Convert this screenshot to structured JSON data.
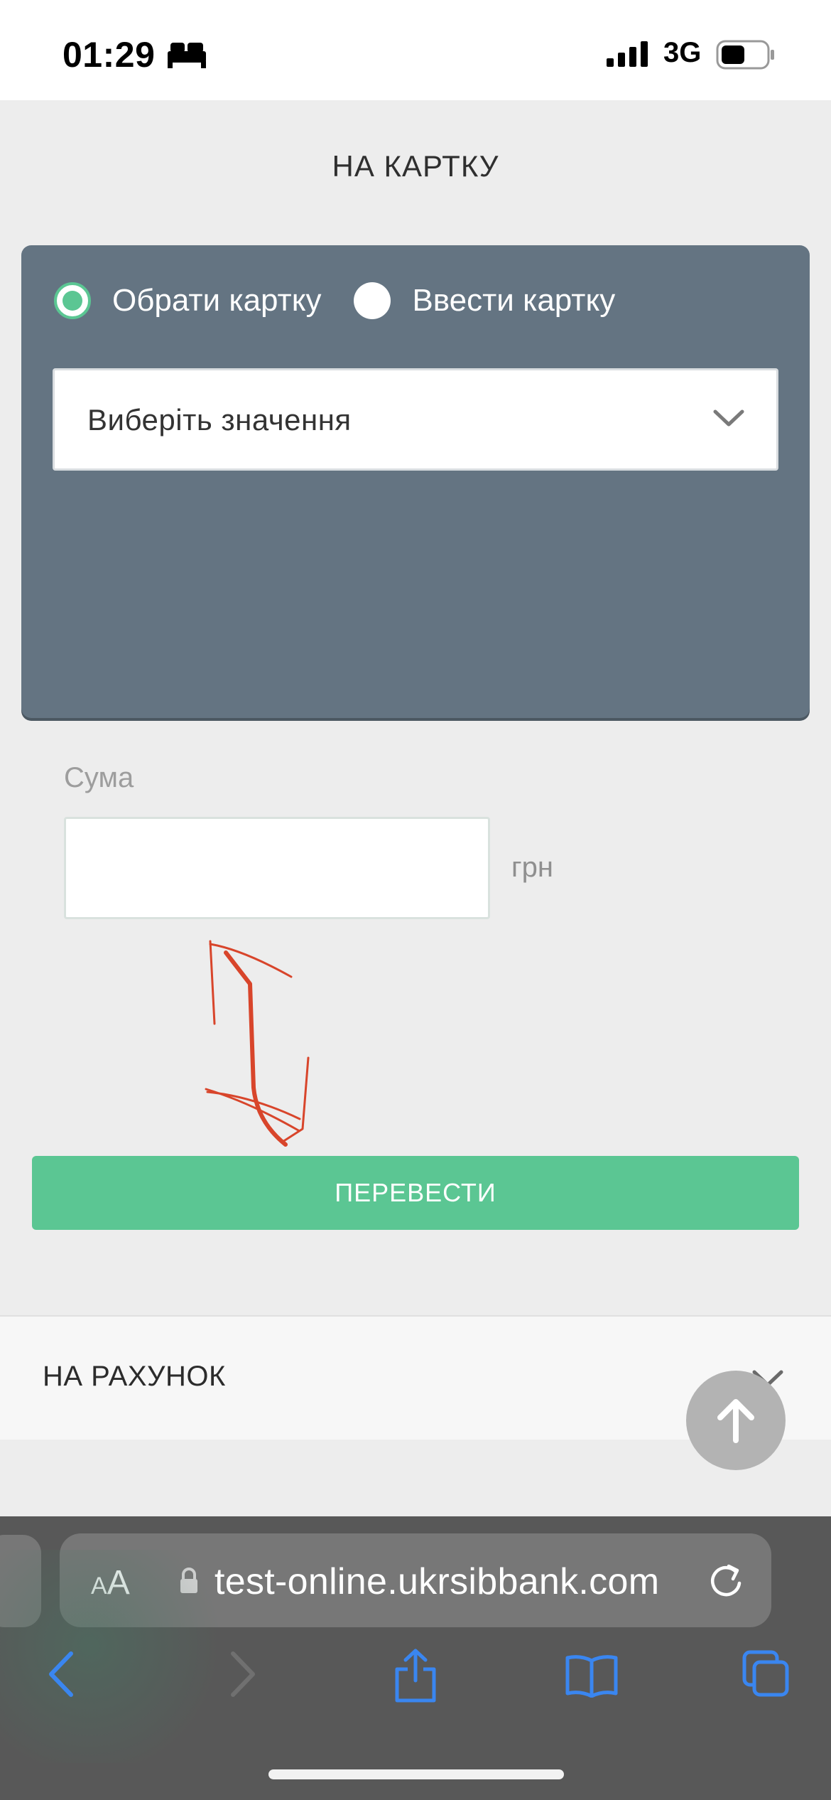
{
  "status_bar": {
    "time": "01:29",
    "network": "3G",
    "sleep_icon": "bed-icon",
    "signal_icon": "cellular-signal-icon",
    "battery_icon": "battery-icon"
  },
  "transfer": {
    "section_title": "НА КАРТКУ",
    "card_source": {
      "options": [
        "Обрати картку",
        "Ввести картку"
      ],
      "selected": "Обрати картку"
    },
    "card_select": {
      "placeholder": "Виберіть значення"
    },
    "amount": {
      "label": "Сума",
      "value": "",
      "currency": "грн"
    },
    "submit_label": "ПЕРЕВЕСТИ"
  },
  "accordion": {
    "title": "НА РАХУНОК"
  },
  "browser": {
    "text_size_label_small": "A",
    "text_size_label_large": "A",
    "url": "test-online.ukrsibbank.com"
  },
  "colors": {
    "accent": "#5bc693",
    "panel": "#647482",
    "page_bg": "#ededed",
    "annotation": "#d8452b",
    "browser_chrome": "#585858"
  }
}
